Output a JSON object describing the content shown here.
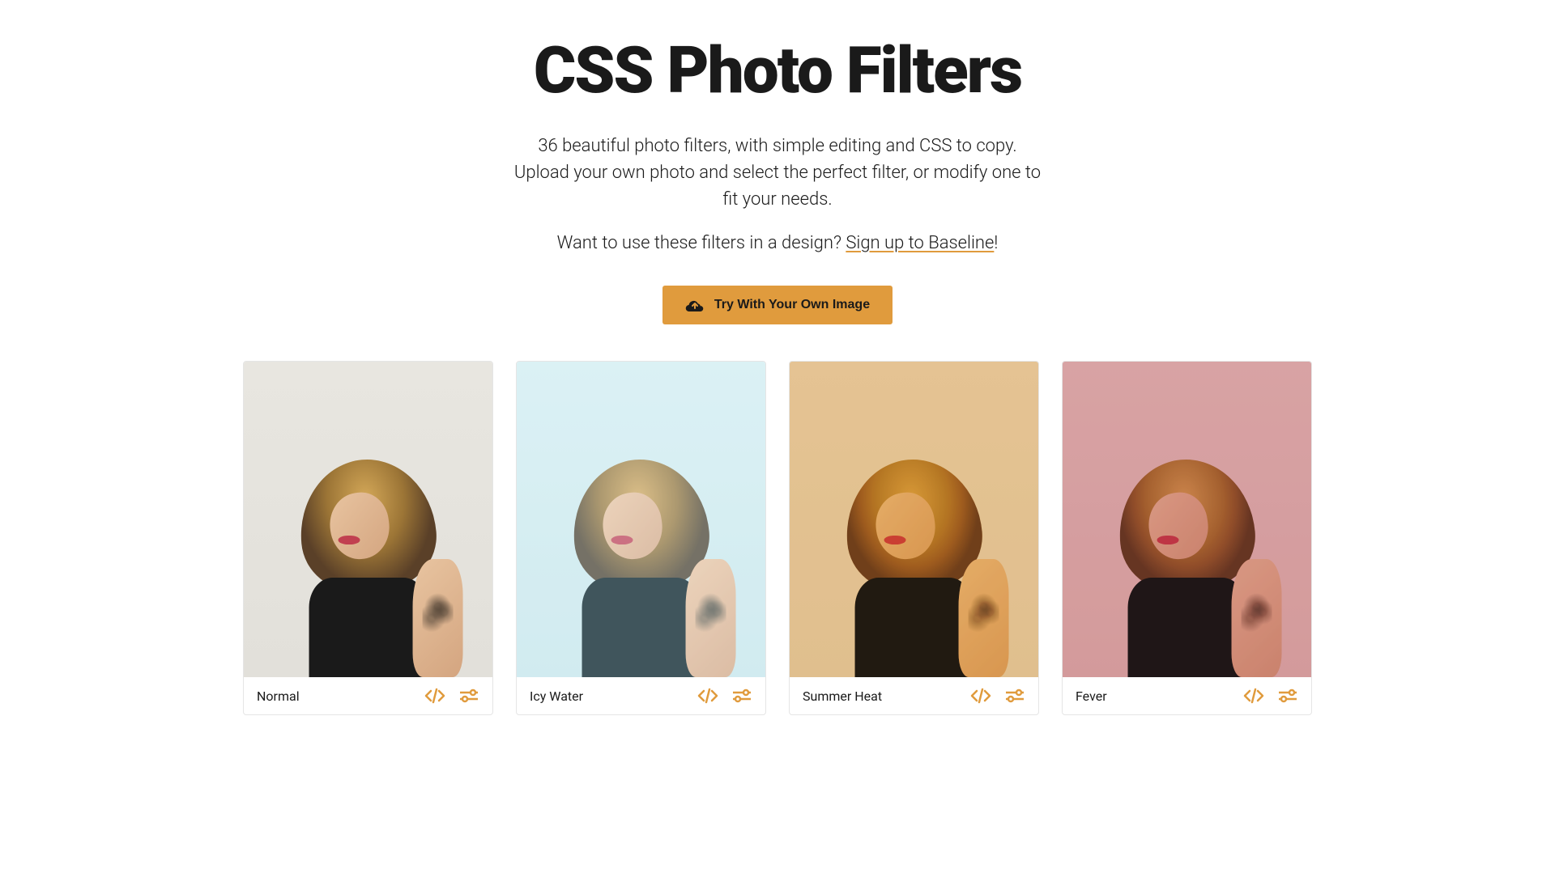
{
  "header": {
    "title": "CSS Photo Filters",
    "description": "36 beautiful photo filters, with simple editing and CSS to copy. Upload your own photo and select the perfect filter, or modify one to fit your needs.",
    "cta_prefix": "Want to use these filters in a design? ",
    "cta_link_text": "Sign up to Baseline",
    "cta_suffix": "!",
    "upload_button_label": "Try With Your Own Image"
  },
  "filters": [
    {
      "name": "Normal",
      "class": "filter-normal"
    },
    {
      "name": "Icy Water",
      "class": "filter-icy-water"
    },
    {
      "name": "Summer Heat",
      "class": "filter-summer-heat"
    },
    {
      "name": "Fever",
      "class": "filter-fever"
    }
  ],
  "colors": {
    "accent": "#e09b3d",
    "text": "#1a1a1a"
  },
  "icons": {
    "upload": "cloud-upload-icon",
    "code": "code-icon",
    "sliders": "sliders-icon"
  }
}
